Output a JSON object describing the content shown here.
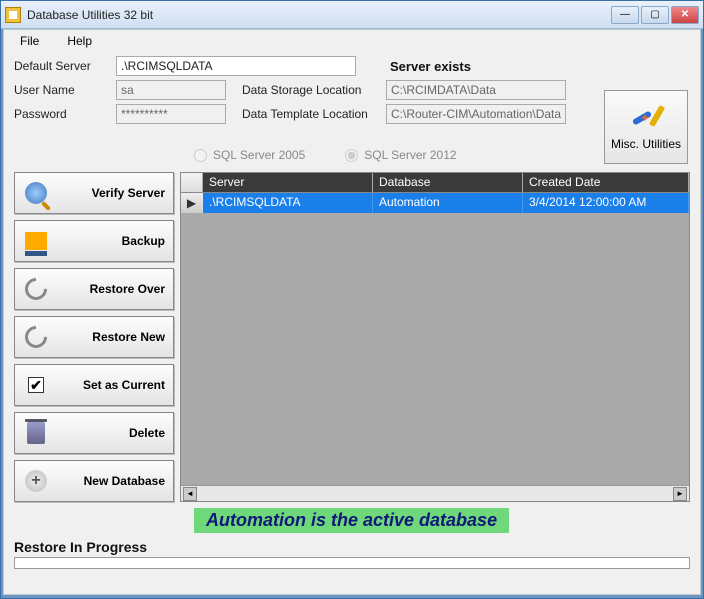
{
  "window": {
    "title": "Database Utilities 32 bit"
  },
  "menu": {
    "file": "File",
    "help": "Help"
  },
  "form": {
    "defaultServer_label": "Default Server",
    "defaultServer_value": ".\\RCIMSQLDATA",
    "userName_label": "User Name",
    "userName_value": "sa",
    "password_label": "Password",
    "password_value": "**********",
    "serverExists": "Server exists",
    "dataStorage_label": "Data Storage Location",
    "dataStorage_value": "C:\\RCIMDATA\\Data",
    "dataTemplate_label": "Data Template Location",
    "dataTemplate_value": "C:\\Router-CIM\\Automation\\Database\\Ba"
  },
  "misc": {
    "label": "Misc. Utilities"
  },
  "radios": {
    "sql2005": "SQL Server 2005",
    "sql2012": "SQL Server 2012"
  },
  "buttons": {
    "verify": "Verify Server",
    "backup": "Backup",
    "restoreOver": "Restore Over",
    "restoreNew": "Restore New",
    "setCurrent": "Set as Current",
    "delete": "Delete",
    "newDb": "New Database"
  },
  "grid": {
    "headers": {
      "server": "Server",
      "database": "Database",
      "created": "Created Date"
    },
    "row": {
      "server": ".\\RCIMSQLDATA",
      "database": "Automation",
      "created": "3/4/2014 12:00:00 AM"
    }
  },
  "banner": "Automation is the active database",
  "progress_label": "Restore In Progress"
}
